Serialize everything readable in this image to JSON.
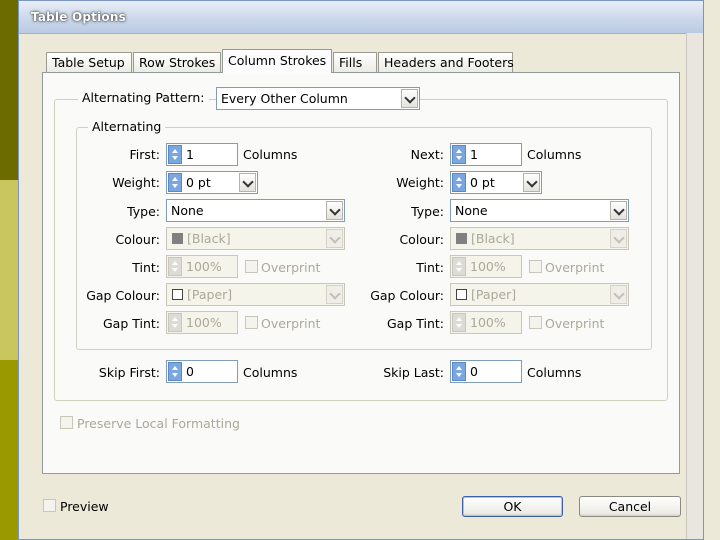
{
  "window": {
    "title": "Table Options"
  },
  "tabs": [
    {
      "label": "Table Setup",
      "active": false
    },
    {
      "label": "Row Strokes",
      "active": false
    },
    {
      "label": "Column Strokes",
      "active": true
    },
    {
      "label": "Fills",
      "active": false
    },
    {
      "label": "Headers and Footers",
      "active": false
    }
  ],
  "alternating_pattern": {
    "label": "Alternating Pattern:",
    "value": "Every Other Column"
  },
  "group": {
    "legend": "Alternating"
  },
  "first": {
    "count_label": "First:",
    "count_value": "1",
    "count_unit": "Columns",
    "weight_label": "Weight:",
    "weight_value": "0 pt",
    "type_label": "Type:",
    "type_value": "None",
    "colour_label": "Colour:",
    "colour_value": "[Black]",
    "tint_label": "Tint:",
    "tint_value": "100%",
    "overprint_label": "Overprint",
    "gap_colour_label": "Gap Colour:",
    "gap_colour_value": "[Paper]",
    "gap_tint_label": "Gap Tint:",
    "gap_tint_value": "100%",
    "gap_overprint_label": "Overprint"
  },
  "next": {
    "count_label": "Next:",
    "count_value": "1",
    "count_unit": "Columns",
    "weight_label": "Weight:",
    "weight_value": "0 pt",
    "type_label": "Type:",
    "type_value": "None",
    "colour_label": "Colour:",
    "colour_value": "[Black]",
    "tint_label": "Tint:",
    "tint_value": "100%",
    "overprint_label": "Overprint",
    "gap_colour_label": "Gap Colour:",
    "gap_colour_value": "[Paper]",
    "gap_tint_label": "Gap Tint:",
    "gap_tint_value": "100%",
    "gap_overprint_label": "Overprint"
  },
  "skip": {
    "first_label": "Skip First:",
    "first_value": "0",
    "first_unit": "Columns",
    "last_label": "Skip Last:",
    "last_value": "0",
    "last_unit": "Columns"
  },
  "preserve_local_formatting": {
    "label": "Preserve Local Formatting",
    "checked": false
  },
  "preview": {
    "label": "Preview",
    "checked": false
  },
  "buttons": {
    "ok": "OK",
    "cancel": "Cancel"
  },
  "colors": {
    "swatch_black": "#808080",
    "swatch_paper": "#ffffff",
    "spin_active": "#7aa7e0"
  }
}
